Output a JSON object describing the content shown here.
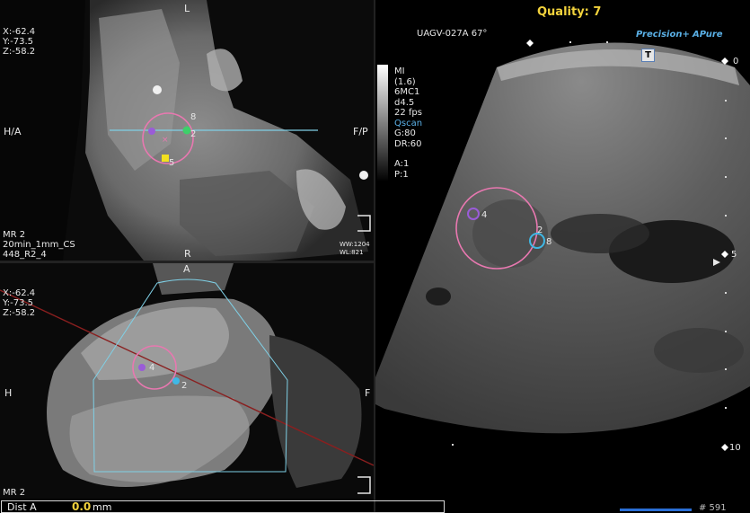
{
  "mr_top": {
    "coords": [
      "X:-62.4",
      "Y:-73.5",
      "Z:-58.2"
    ],
    "orient_top": "L",
    "orient_left": "H/A",
    "orient_right": "F/P",
    "orient_bottom": "R",
    "series": [
      "MR 2",
      "20min_1mm_CS",
      "448_R2_4"
    ],
    "window": [
      "WW:1204",
      "WL:821"
    ],
    "markers": [
      "8",
      "2",
      "5"
    ]
  },
  "mr_bottom": {
    "coords": [
      "X:-62.4",
      "Y:-73.5",
      "Z:-58.2"
    ],
    "orient_top": "A",
    "orient_left": "H",
    "orient_right": "F",
    "series": "MR 2",
    "markers": [
      "4",
      "2"
    ]
  },
  "ultrasound": {
    "quality": "Quality: 7",
    "probe": "UAGV-027A 67°",
    "precision": "Precision+",
    "apure": "APure",
    "t_badge": "T",
    "params": [
      "MI",
      "(1.6)",
      "6MC1",
      "d4.5",
      "22 fps",
      "Qscan",
      "G:80",
      "DR:60",
      "",
      "A:1",
      "P:1"
    ],
    "depth_marks": [
      "0",
      "5",
      "10"
    ],
    "markers": [
      "4",
      "2",
      "8"
    ]
  },
  "measurement": {
    "label": "Dist A",
    "value": "0.0",
    "unit": "mm"
  },
  "frame_counter": "# 591",
  "colors": {
    "target_circle": "#e878b0",
    "crosshair": "#7fd0e6",
    "marker_purple": "#9a5cd8",
    "marker_green": "#3ed06a",
    "marker_yellow": "#f2e020",
    "marker_cyan": "#3fb8e6",
    "plane_line": "#8a1f1f",
    "quality_text": "#f2d23c"
  }
}
